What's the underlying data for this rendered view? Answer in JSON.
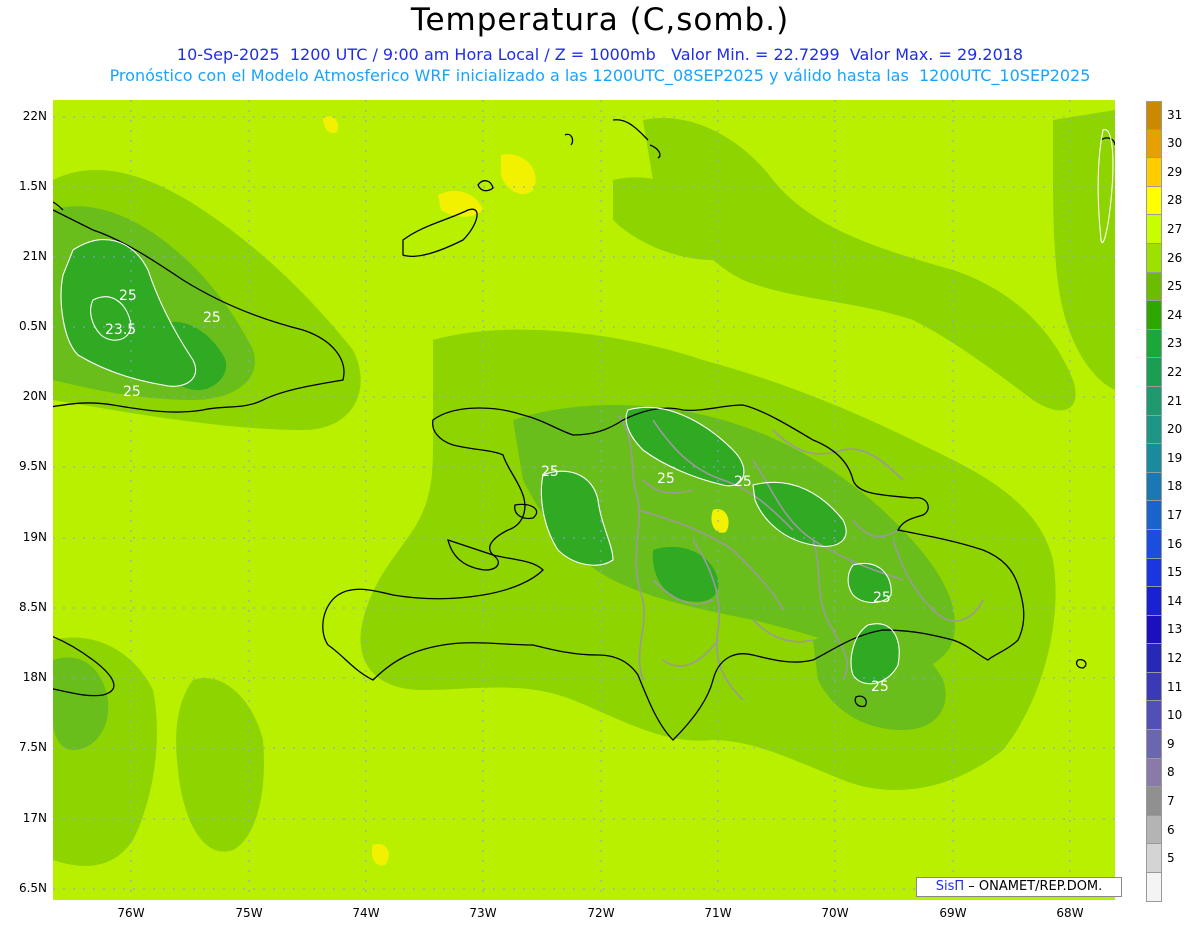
{
  "header": {
    "title": "Temperatura (C,somb.)",
    "line1": "10-Sep-2025  1200 UTC / 9:00 am Hora Local / Z = 1000mb   Valor Min. = 22.7299  Valor Max. = 29.2018",
    "line2": "Pronóstico con el Modelo Atmosferico WRF inicializado a las 1200UTC_08SEP2025 y válido hasta las  1200UTC_10SEP2025"
  },
  "map": {
    "lat_labels": [
      "22N",
      "1.5N",
      "21N",
      "0.5N",
      "20N",
      "9.5N",
      "19N",
      "8.5N",
      "18N",
      "7.5N",
      "17N",
      "6.5N"
    ],
    "lon_labels": [
      "76W",
      "75W",
      "74W",
      "73W",
      "72W",
      "71W",
      "70W",
      "69W",
      "68W"
    ],
    "contour_labels": [
      "25",
      "23.5",
      "25",
      "25",
      "25",
      "25",
      "25",
      "25",
      "25"
    ],
    "colors": {
      "background": "#b8f000",
      "level_26": "#8ed400",
      "level_25": "#6abe1c",
      "level_24": "#2faa22",
      "level_28": "#f2f200",
      "coast": "#000000",
      "provinces": "#9a9a9a",
      "grid": "#8f9cf0"
    }
  },
  "colorbar": {
    "labels": [
      "31",
      "30",
      "29",
      "28",
      "27",
      "26",
      "25",
      "24",
      "23",
      "22",
      "21",
      "20",
      "19",
      "18",
      "17",
      "16",
      "15",
      "14",
      "13",
      "12",
      "11",
      "10",
      "9",
      "8",
      "7",
      "6",
      "5"
    ],
    "colors": [
      "#cc8800",
      "#e8a000",
      "#ffcc00",
      "#ffff00",
      "#c8ff00",
      "#9ee000",
      "#6cbd00",
      "#2ea800",
      "#1aa838",
      "#1a9e52",
      "#1e9a6e",
      "#1e9686",
      "#1a8a9c",
      "#1a78b4",
      "#1a62cc",
      "#1a4ede",
      "#1a36e0",
      "#1a20d4",
      "#1a10c0",
      "#2828b8",
      "#3a3ab8",
      "#5050b8",
      "#6a66b0",
      "#8a7aaa",
      "#909090",
      "#b4b4b4",
      "#d4d4d4",
      "#f4f4f4"
    ]
  },
  "credit": {
    "logo": "SisΠ",
    "text": "– ONAMET/REP.DOM."
  }
}
